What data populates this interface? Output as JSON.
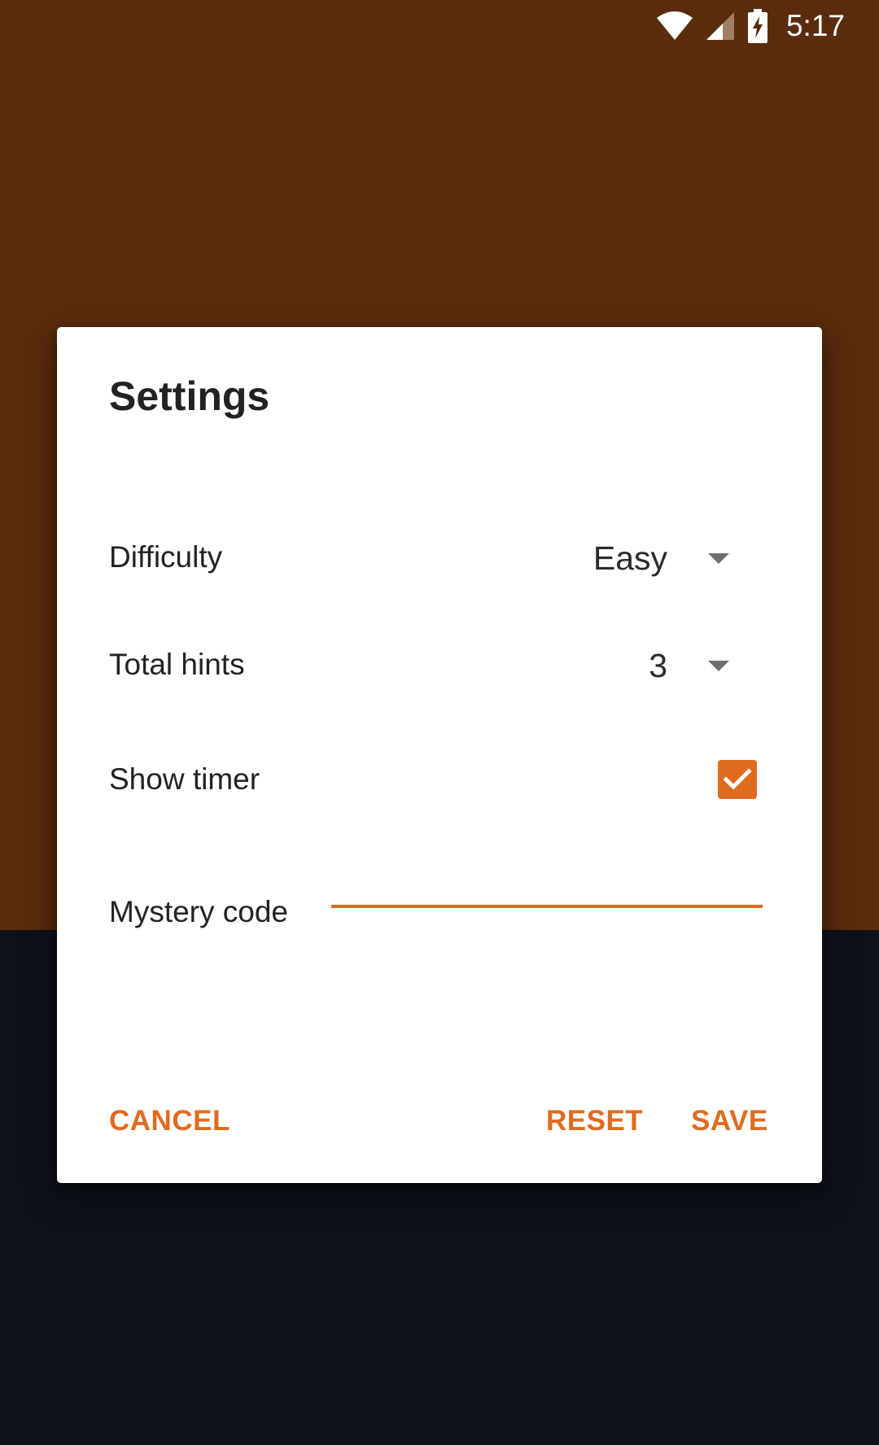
{
  "status_bar": {
    "time": "5:17",
    "icons": [
      "wifi-icon",
      "cell-signal-icon",
      "battery-charging-icon"
    ]
  },
  "colors": {
    "accent": "#e06b1f",
    "background_top": "#5a2b0c",
    "background_bottom": "#0d1119",
    "dialog": "#ffffff"
  },
  "dialog": {
    "title": "Settings",
    "difficulty": {
      "label": "Difficulty",
      "selected": "Easy"
    },
    "total_hints": {
      "label": "Total hints",
      "selected": "3"
    },
    "show_timer": {
      "label": "Show timer",
      "checked": true
    },
    "mystery_code": {
      "label": "Mystery code",
      "value": "",
      "placeholder": ""
    },
    "buttons": {
      "cancel": "CANCEL",
      "reset": "RESET",
      "save": "SAVE"
    }
  }
}
